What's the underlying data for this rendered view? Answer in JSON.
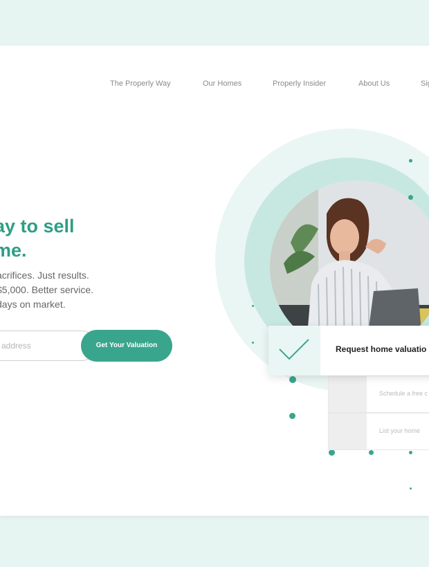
{
  "nav": {
    "items": [
      "The Properly Way",
      "Our Homes",
      "Properly Insider",
      "About Us",
      "Sig"
    ]
  },
  "hero": {
    "headline_line1": "ay to sell",
    "headline_line2": "me.",
    "sub_line1": "acrifices. Just results.",
    "sub_line2": "$5,000. Better service.",
    "sub_line3": "days on market.",
    "email_placeholder": "address",
    "cta_label": "Get Your Valuation"
  },
  "valuation_card": {
    "title": "Request home valuatio",
    "options": [
      "Schedule a free c",
      "List your home"
    ]
  },
  "colors": {
    "accent": "#3aa58d",
    "headline": "#2f9e86",
    "background": "#e6f4f2",
    "circle_light": "#eaf6f4",
    "circle_mid": "#c7e8e0"
  }
}
